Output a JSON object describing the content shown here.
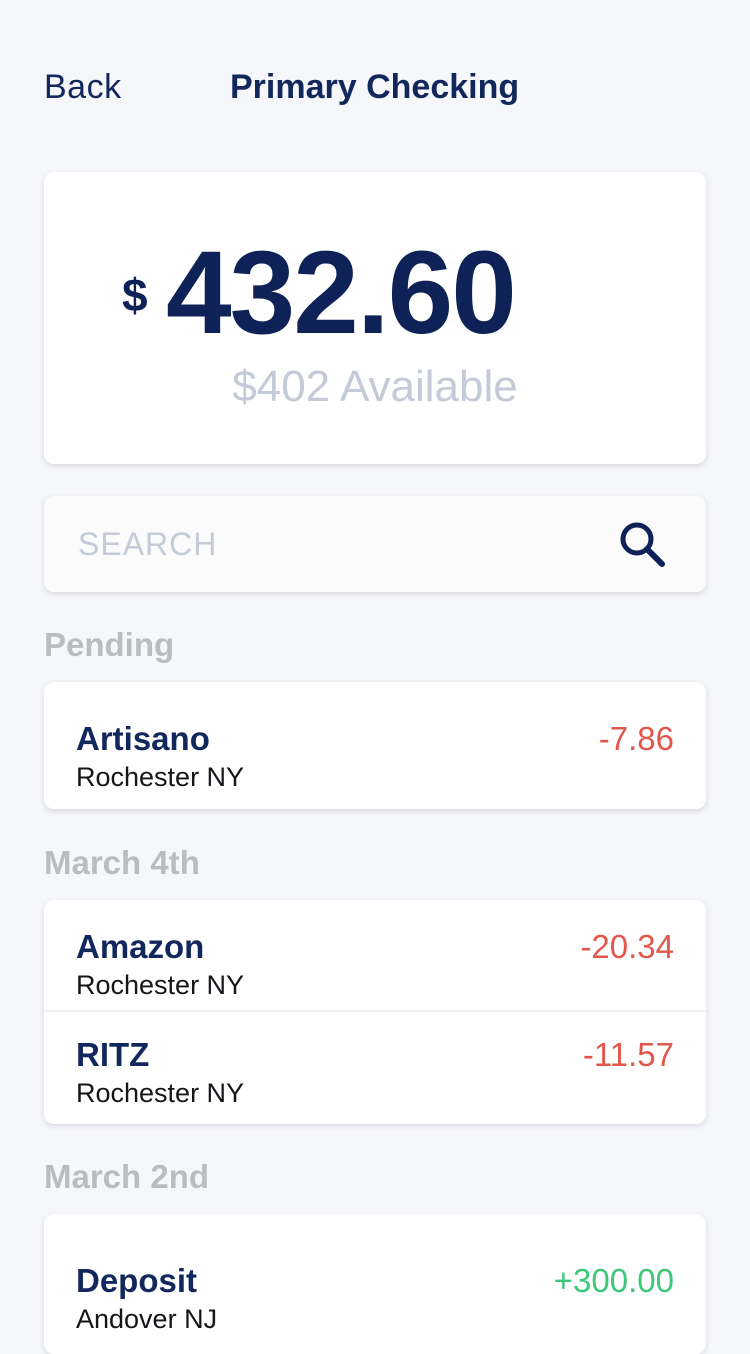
{
  "nav": {
    "back_label": "Back",
    "title": "Primary Checking"
  },
  "balance": {
    "currency_symbol": "$",
    "amount": "432.60",
    "available": "$402 Available"
  },
  "search": {
    "placeholder": "SEARCH"
  },
  "sections": [
    {
      "label": "Pending",
      "transactions": [
        {
          "name": "Artisano",
          "location": "Rochester NY",
          "amount": "-7.86"
        }
      ]
    },
    {
      "label": "March 4th",
      "transactions": [
        {
          "name": "Amazon",
          "location": "Rochester NY",
          "amount": "-20.34"
        },
        {
          "name": "RITZ",
          "location": "Rochester NY",
          "amount": "-11.57"
        }
      ]
    },
    {
      "label": "March 2nd",
      "transactions": [
        {
          "name": "Deposit",
          "location": "Andover NJ",
          "amount": "+300.00"
        }
      ]
    }
  ],
  "colors": {
    "primary": "#12285c",
    "negative": "#e2574c",
    "positive": "#3cc77a",
    "muted": "#c4cad7"
  }
}
